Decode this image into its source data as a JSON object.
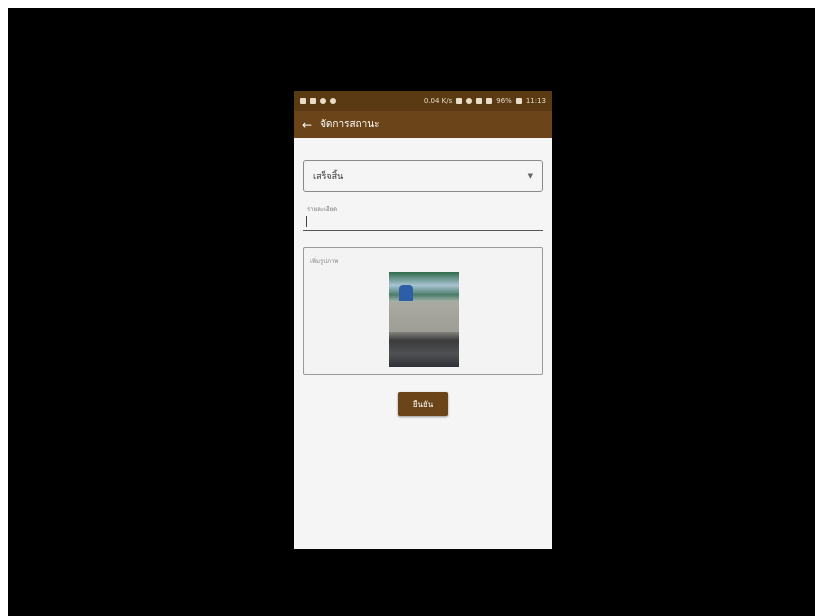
{
  "status_bar": {
    "network_speed": "0.04 K/s",
    "battery": "96%",
    "time": "11:13"
  },
  "app_bar": {
    "title": "จัดการสถานะ"
  },
  "form": {
    "status_select": {
      "value": "เสร็จสิ้น"
    },
    "note_field": {
      "label": "รายละเอียด",
      "value": ""
    },
    "image_box": {
      "label": "เพิ่มรูปภาพ"
    },
    "confirm_label": "ยืนยัน"
  },
  "colors": {
    "app_bar": "#6b4519",
    "status_bar": "#5a3a12",
    "button": "#6b4519"
  }
}
